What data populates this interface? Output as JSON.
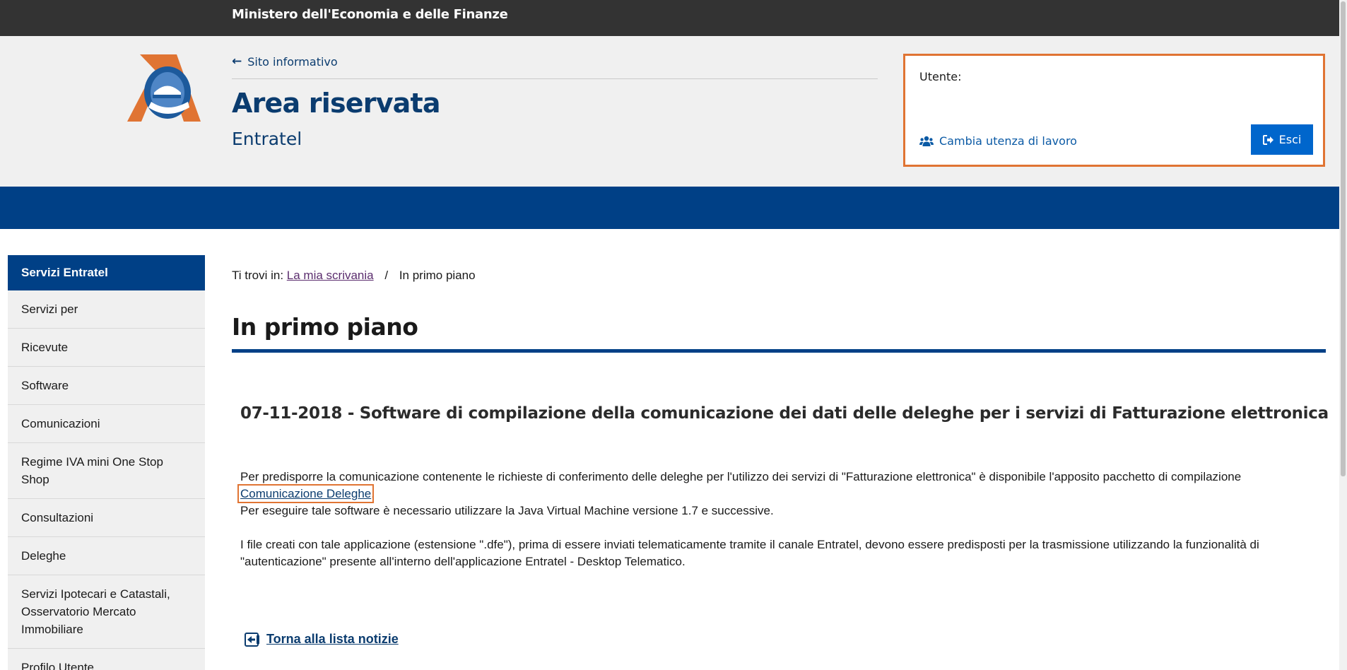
{
  "topbar": {
    "ministry": "Ministero dell'Economia e delle Finanze"
  },
  "header": {
    "back_link": "Sito informativo",
    "title": "Area riservata",
    "subtitle": "Entratel"
  },
  "user_panel": {
    "label": "Utente:",
    "change_link": "Cambia utenza di lavoro",
    "logout": "Esci"
  },
  "sidebar": {
    "heading": "Servizi Entratel",
    "items": [
      {
        "label": "Servizi per"
      },
      {
        "label": "Ricevute"
      },
      {
        "label": "Software"
      },
      {
        "label": "Comunicazioni"
      },
      {
        "label": "Regime IVA mini One Stop Shop"
      },
      {
        "label": "Consultazioni"
      },
      {
        "label": "Deleghe"
      },
      {
        "label": "Servizi Ipotecari e Catastali, Osservatorio Mercato Immobiliare"
      },
      {
        "label": "Profilo Utente"
      }
    ]
  },
  "breadcrumb": {
    "prefix": "Ti trovi in:",
    "link": "La mia scrivania",
    "separator": "/",
    "current": "In primo piano"
  },
  "main": {
    "title": "In primo piano",
    "news_title": "07-11-2018 - Software di compilazione della comunicazione dei dati delle deleghe per i servizi di Fatturazione elettronica",
    "para1_text": "Per predisporre la comunicazione contenente le richieste di conferimento delle deleghe per l'utilizzo dei servizi di \"Fatturazione elettronica\" è disponibile l'apposito pacchetto di compilazione ",
    "para1_link": "Comunicazione Deleghe",
    "para1_end": ".",
    "para1_line2": "Per eseguire tale software è necessario utilizzare la Java Virtual Machine versione 1.7 e successive.",
    "para2": "I file creati con tale applicazione (estensione \".dfe\"), prima di essere inviati telematicamente tramite il canale Entratel, devono essere predisposti per la trasmissione utilizzando la funzionalità di \"autenticazione\" presente all'interno dell'applicazione Entratel - Desktop Telematico.",
    "back_to_list": "Torna alla lista notizie"
  },
  "colors": {
    "primary_blue": "#004086",
    "accent_orange": "#e07433",
    "button_blue": "#0066cc",
    "topbar": "#333333"
  },
  "icons": [
    "agenzia-entrate-logo",
    "arrow-left-icon",
    "users-icon",
    "sign-out-icon",
    "back-to-list-icon"
  ]
}
